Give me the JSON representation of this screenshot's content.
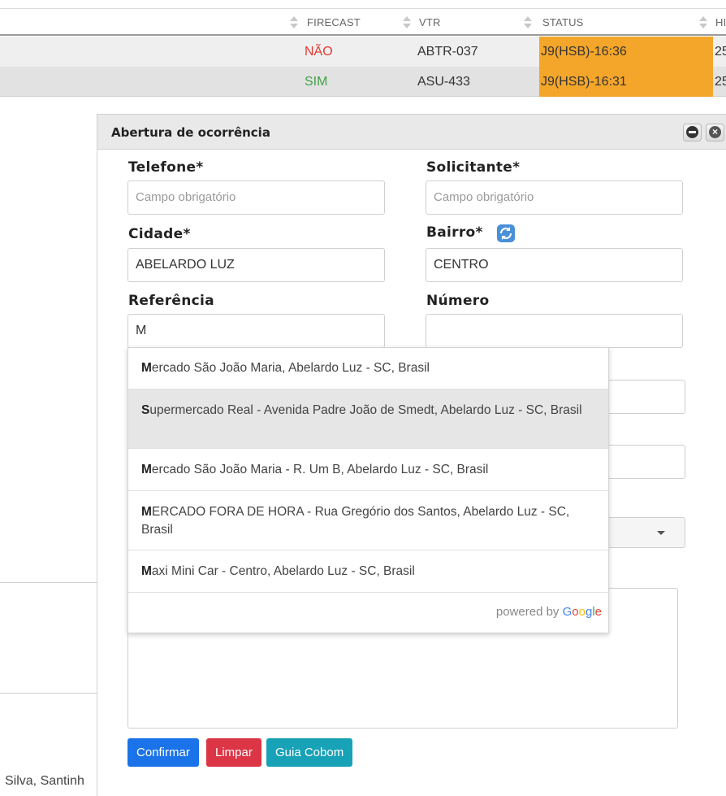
{
  "table": {
    "headers": [
      "FIRECAST",
      "VTR",
      "STATUS",
      "HI"
    ],
    "rows": [
      {
        "firecast": "NÃO",
        "vtr": "ABTR-037",
        "status": "J9(HSB)-16:36",
        "extra": "25"
      },
      {
        "firecast": "SIM",
        "vtr": "ASU-433",
        "status": "J9(HSB)-16:31",
        "extra": "25"
      }
    ]
  },
  "colors": {
    "nao": "#e53935",
    "sim": "#43a047",
    "status_bg": "#f4a62a"
  },
  "background_text": "Silva, Santinh",
  "dialog": {
    "title": "Abertura de ocorrência",
    "fields": {
      "telefone": {
        "label": "Telefone*",
        "placeholder": "Campo obrigatório"
      },
      "solicitante": {
        "label": "Solicitante*",
        "placeholder": "Campo obrigatório"
      },
      "cidade": {
        "label": "Cidade*",
        "value": "ABELARDO LUZ"
      },
      "bairro": {
        "label": "Bairro*",
        "value": "CENTRO"
      },
      "referencia": {
        "label": "Referência",
        "value": "M"
      },
      "numero": {
        "label": "Número",
        "value": ""
      }
    },
    "buttons": {
      "confirmar": "Confirmar",
      "limpar": "Limpar",
      "guia": "Guia Cobom"
    }
  },
  "autocomplete": {
    "items": [
      {
        "match": "M",
        "rest": "ercado São João Maria, Abelardo Luz - SC, Brasil"
      },
      {
        "match": "S",
        "rest": "upermercado Real - Avenida Padre João de Smedt, Abelardo Luz - SC, Brasil"
      },
      {
        "match": "M",
        "rest": "ercado São João Maria - R. Um B, Abelardo Luz - SC, Brasil"
      },
      {
        "match": "M",
        "rest": "ERCADO FORA DE HORA - Rua Gregório dos Santos, Abelardo Luz - SC, Brasil"
      },
      {
        "match": "M",
        "rest": "axi Mini Car - Centro, Abelardo Luz - SC, Brasil"
      }
    ],
    "powered_by": "powered by",
    "google": [
      "G",
      "o",
      "o",
      "g",
      "l",
      "e"
    ]
  }
}
